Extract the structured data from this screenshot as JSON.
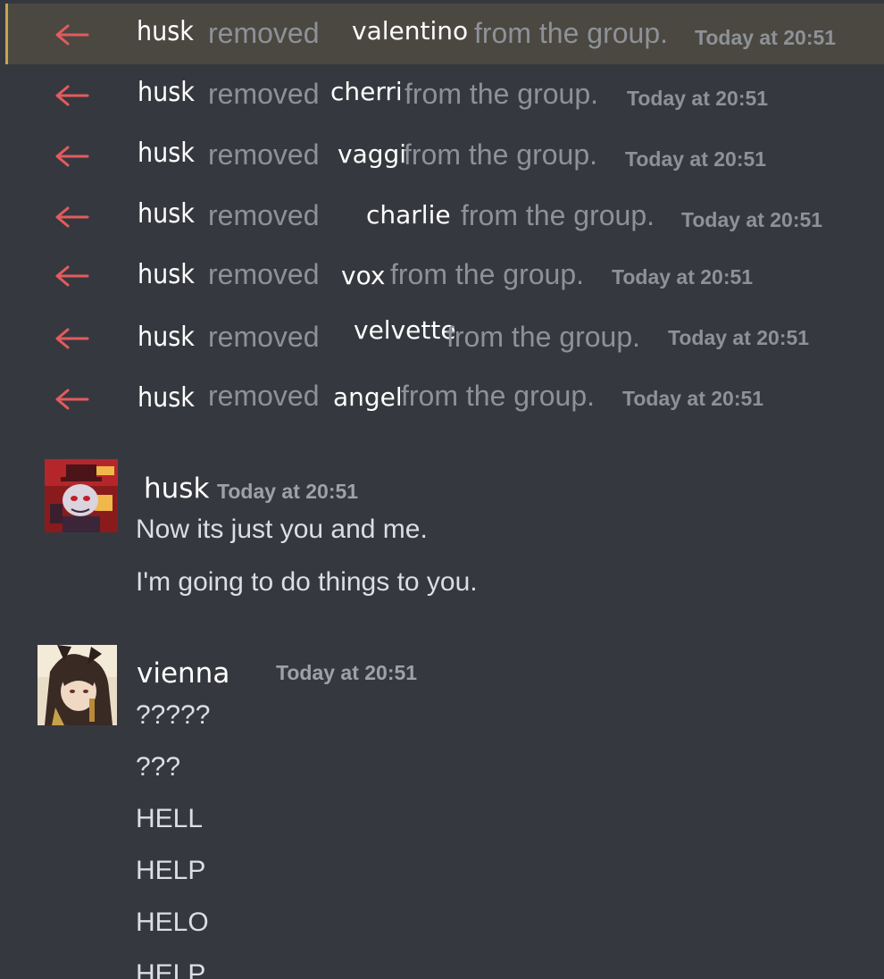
{
  "system_messages": [
    {
      "actor": "husk",
      "verb": "removed",
      "target": "valentino",
      "rest": "from the group.",
      "time": "Today at 20:51"
    },
    {
      "actor": "husk",
      "verb": "removed",
      "target": "cherri",
      "rest": "from the group.",
      "time": "Today at 20:51"
    },
    {
      "actor": "husk",
      "verb": "removed",
      "target": "vaggi",
      "rest": "from the group.",
      "time": "Today at 20:51"
    },
    {
      "actor": "husk",
      "verb": "removed",
      "target": "charlie",
      "rest": "from the group.",
      "time": "Today at 20:51"
    },
    {
      "actor": "husk",
      "verb": "removed",
      "target": "vox",
      "rest": "from the group.",
      "time": "Today at 20:51"
    },
    {
      "actor": "husk",
      "verb": "removed",
      "target": "velvette",
      "rest": "from the group.",
      "time": "Today at 20:51"
    },
    {
      "actor": "husk",
      "verb": "removed",
      "target": "angel",
      "rest": "from the group.",
      "time": "Today at 20:51"
    }
  ],
  "messages": [
    {
      "author": "husk",
      "time": "Today at 20:51",
      "lines": [
        "Now its just you and me.",
        "I'm going to do things to you."
      ]
    },
    {
      "author": "vienna",
      "time": "Today at 20:51",
      "lines": [
        "?????",
        "???",
        "HELL",
        "HELP",
        "HELO",
        "HELP"
      ]
    }
  ],
  "icons": {
    "system_icon": "member-removed-arrow-icon"
  },
  "colors": {
    "background": "#36383f",
    "highlight": "#4a4840",
    "highlight_bar": "#c8a44a",
    "arrow": "#e35b5d",
    "muted_text": "#8e9197",
    "body_text": "#dcdee2"
  }
}
